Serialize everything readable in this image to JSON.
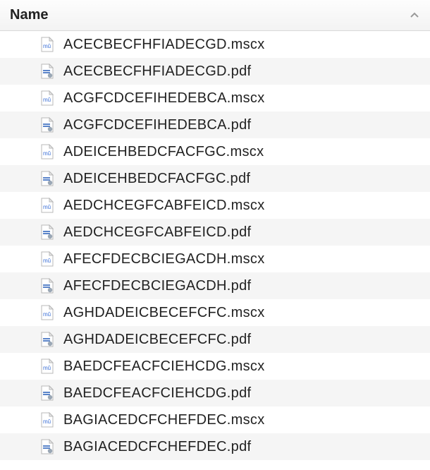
{
  "header": {
    "column_label": "Name",
    "sort_direction": "ascending"
  },
  "icons": {
    "mscx": "musescore-file-icon",
    "pdf": "pdf-file-icon"
  },
  "files": [
    {
      "name": "ACECBECFHFIADECGD.mscx",
      "type": "mscx"
    },
    {
      "name": "ACECBECFHFIADECGD.pdf",
      "type": "pdf"
    },
    {
      "name": "ACGFCDCEFIHEDEBCA.mscx",
      "type": "mscx"
    },
    {
      "name": "ACGFCDCEFIHEDEBCA.pdf",
      "type": "pdf"
    },
    {
      "name": "ADEICEHBEDCFACFGC.mscx",
      "type": "mscx"
    },
    {
      "name": "ADEICEHBEDCFACFGC.pdf",
      "type": "pdf"
    },
    {
      "name": "AEDCHCEGFCABFEICD.mscx",
      "type": "mscx"
    },
    {
      "name": "AEDCHCEGFCABFEICD.pdf",
      "type": "pdf"
    },
    {
      "name": "AFECFDECBCIEGACDH.mscx",
      "type": "mscx"
    },
    {
      "name": "AFECFDECBCIEGACDH.pdf",
      "type": "pdf"
    },
    {
      "name": "AGHDADEICBECEFCFC.mscx",
      "type": "mscx"
    },
    {
      "name": "AGHDADEICBECEFCFC.pdf",
      "type": "pdf"
    },
    {
      "name": "BAEDCFEACFCIEHCDG.mscx",
      "type": "mscx"
    },
    {
      "name": "BAEDCFEACFCIEHCDG.pdf",
      "type": "pdf"
    },
    {
      "name": "BAGIACEDCFCHEFDEC.mscx",
      "type": "mscx"
    },
    {
      "name": "BAGIACEDCFCHEFDEC.pdf",
      "type": "pdf"
    }
  ]
}
